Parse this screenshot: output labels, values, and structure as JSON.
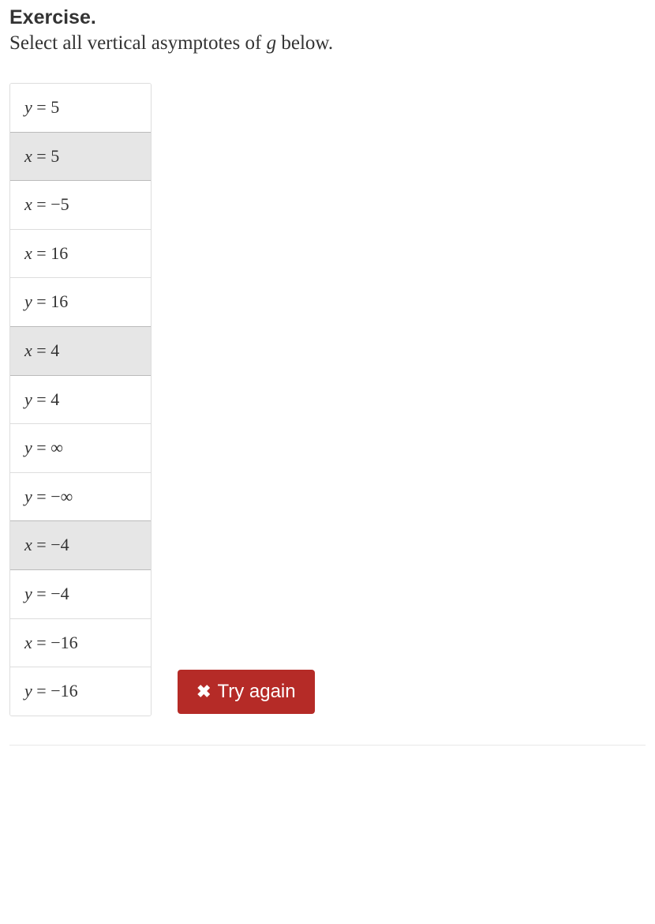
{
  "heading": "Exercise.",
  "prompt_prefix": "Select all vertical asymptotes of ",
  "prompt_var": "g",
  "prompt_suffix": " below.",
  "options": [
    {
      "var": "y",
      "rhs": "5",
      "selected": false
    },
    {
      "var": "x",
      "rhs": "5",
      "selected": true
    },
    {
      "var": "x",
      "rhs": "−5",
      "selected": false
    },
    {
      "var": "x",
      "rhs": "16",
      "selected": false
    },
    {
      "var": "y",
      "rhs": "16",
      "selected": false
    },
    {
      "var": "x",
      "rhs": "4",
      "selected": true
    },
    {
      "var": "y",
      "rhs": "4",
      "selected": false
    },
    {
      "var": "y",
      "rhs": "∞",
      "selected": false
    },
    {
      "var": "y",
      "rhs": "−∞",
      "selected": false
    },
    {
      "var": "x",
      "rhs": "−4",
      "selected": true
    },
    {
      "var": "y",
      "rhs": "−4",
      "selected": false
    },
    {
      "var": "x",
      "rhs": "−16",
      "selected": false
    },
    {
      "var": "y",
      "rhs": "−16",
      "selected": false
    }
  ],
  "try_again_label": "Try again"
}
